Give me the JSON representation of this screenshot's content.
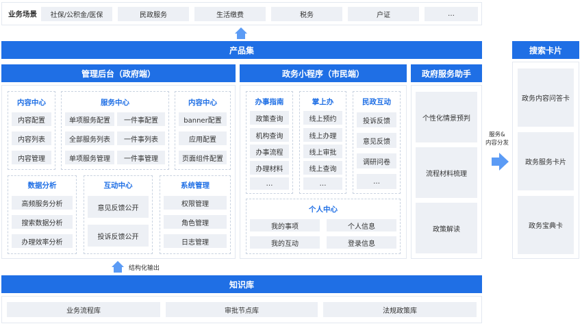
{
  "scenes": {
    "label": "业务场景",
    "items": [
      "社保/公积金/医保",
      "民政服务",
      "生活缴费",
      "税务",
      "户证",
      "…"
    ]
  },
  "product_set": "产品集",
  "admin": {
    "title": "管理后台（政府端）",
    "content_center_1": {
      "title": "内容中心",
      "items": [
        "内容配置",
        "内容列表",
        "内容管理"
      ]
    },
    "service_center": {
      "title": "服务中心",
      "items": [
        "单项服务配置",
        "一件事配置",
        "全部服务列表",
        "一件事列表",
        "单项服务管理",
        "一件事管理"
      ]
    },
    "content_center_2": {
      "title": "内容中心",
      "items": [
        "banner配置",
        "应用配置",
        "页面组件配置"
      ]
    },
    "data_analysis": {
      "title": "数据分析",
      "items": [
        "高频服务分析",
        "搜索数据分析",
        "办理效率分析"
      ]
    },
    "interaction_center": {
      "title": "互动中心",
      "items": [
        "意见反馈公开",
        "投诉反馈公开"
      ]
    },
    "system_mgmt": {
      "title": "系统管理",
      "items": [
        "权限管理",
        "角色管理",
        "日志管理"
      ]
    }
  },
  "miniapp": {
    "title": "政务小程序（市民端）",
    "guide": {
      "title": "办事指南",
      "items": [
        "政策查询",
        "机构查询",
        "办事流程",
        "办理材料",
        "…"
      ]
    },
    "handy": {
      "title": "掌上办",
      "items": [
        "线上预约",
        "线上办理",
        "线上审批",
        "线上查询",
        "…"
      ]
    },
    "civic": {
      "title": "民政互动",
      "items": [
        "投诉反馈",
        "意见反馈",
        "调研问卷",
        "…"
      ]
    },
    "personal": {
      "title": "个人中心",
      "items": [
        "我的事项",
        "个人信息",
        "我的互动",
        "登录信息"
      ]
    }
  },
  "assistant": {
    "title": "政府服务助手",
    "items": [
      "个性化情景预判",
      "流程材料梳理",
      "政策解读"
    ]
  },
  "distribute_label": "服务&\n内容分发",
  "search_cards": {
    "title": "搜索卡片",
    "items": [
      "政务内容问答卡",
      "政务服务卡片",
      "政务宝典卡"
    ]
  },
  "structured_output": "结构化输出",
  "knowledge": {
    "title": "知识库",
    "items": [
      "业务流程库",
      "审批节点库",
      "法规政策库"
    ]
  },
  "colors": {
    "primary": "#1f6fe5",
    "chip": "#edf0f5",
    "arrow": "#5b9bf5"
  }
}
